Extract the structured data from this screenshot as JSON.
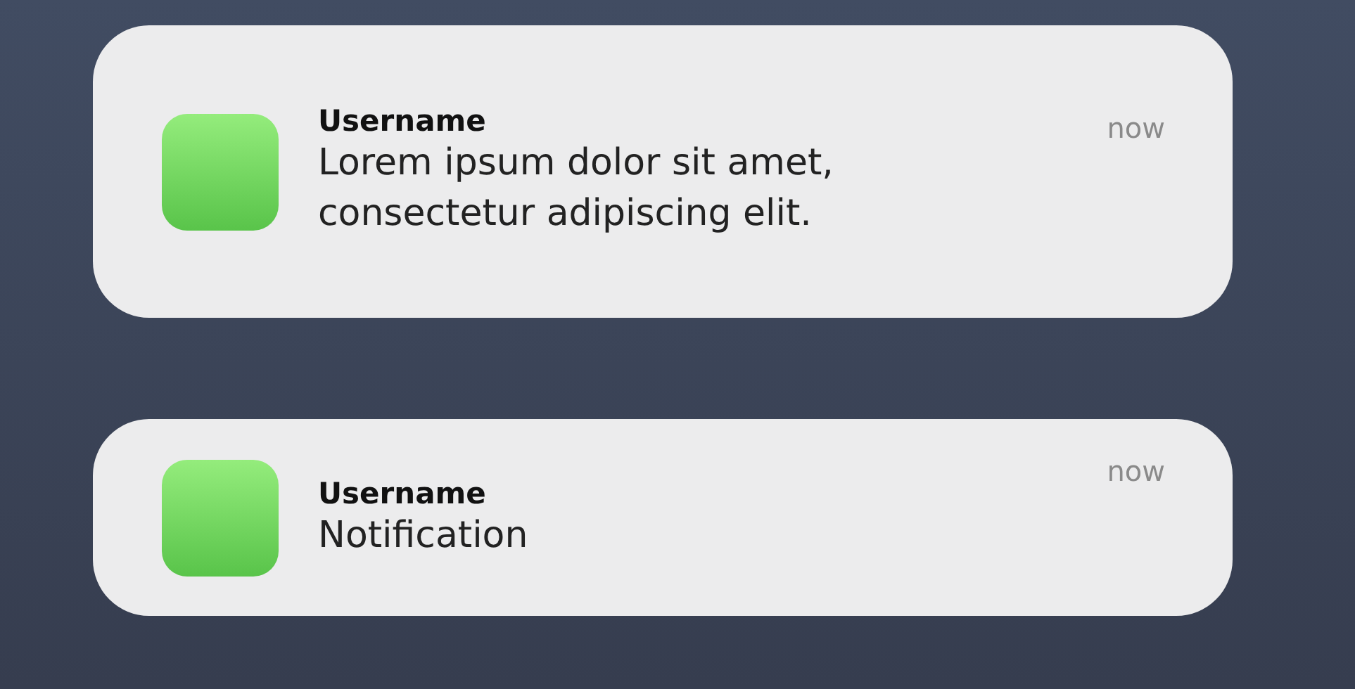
{
  "notifications": [
    {
      "sender": "Username",
      "message": "Lorem ipsum dolor sit amet, consectetur adipiscing elit.",
      "time": "now"
    },
    {
      "sender": "Username",
      "message": "Notification",
      "time": "now"
    }
  ]
}
